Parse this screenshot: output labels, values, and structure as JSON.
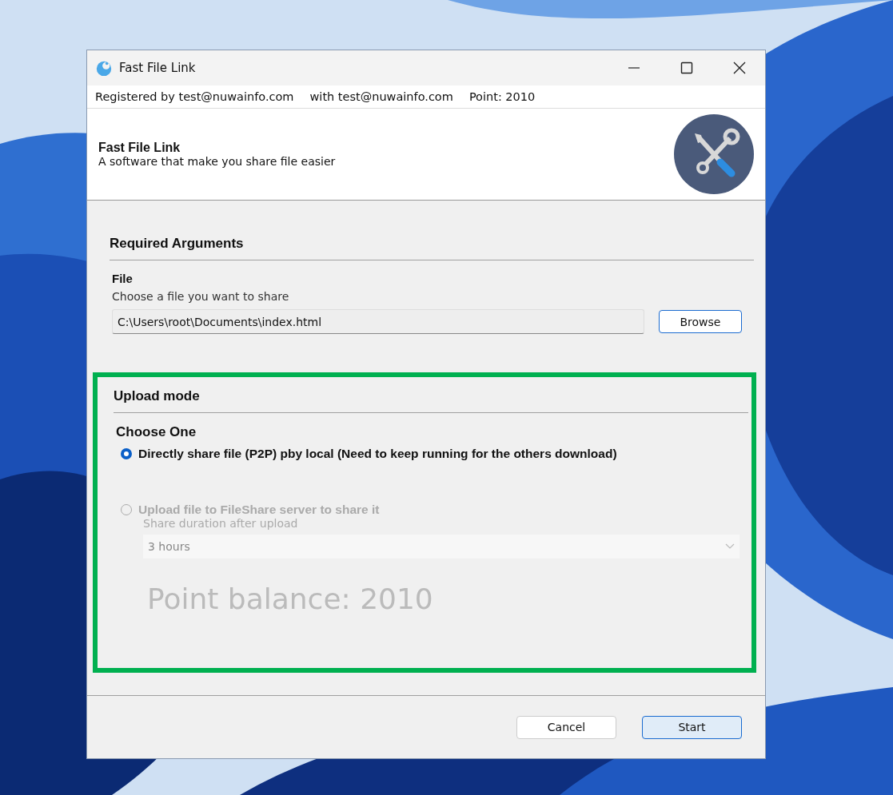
{
  "window": {
    "title": "Fast File Link"
  },
  "registration": [
    "Registered by test@nuwainfo.com",
    "with test@nuwainfo.com",
    "Point: 2010"
  ],
  "header": {
    "title": "Fast File Link",
    "subtitle": "A software that make you share file easier"
  },
  "required": {
    "heading": "Required Arguments",
    "label": "File",
    "hint": "Choose a file you want to share",
    "value": "C:\\Users\\root\\Documents\\index.html",
    "button": "Browse"
  },
  "upload": {
    "heading": "Upload mode",
    "highlighted": true,
    "group_label": "Choose One",
    "options": [
      {
        "label": "Directly share file (P2P) pby local (Need to keep running for the others download)",
        "selected": true,
        "disabled": false
      },
      {
        "label": "Upload file to FileShare server to share it",
        "selected": false,
        "disabled": true
      }
    ],
    "duration_label": "Share duration after upload",
    "duration": "3 hours",
    "duration_disabled": true,
    "balance": "Point balance: 2010"
  },
  "buttons": [
    {
      "label": "Cancel",
      "kind": "normal"
    },
    {
      "label": "Start",
      "kind": "default"
    }
  ]
}
